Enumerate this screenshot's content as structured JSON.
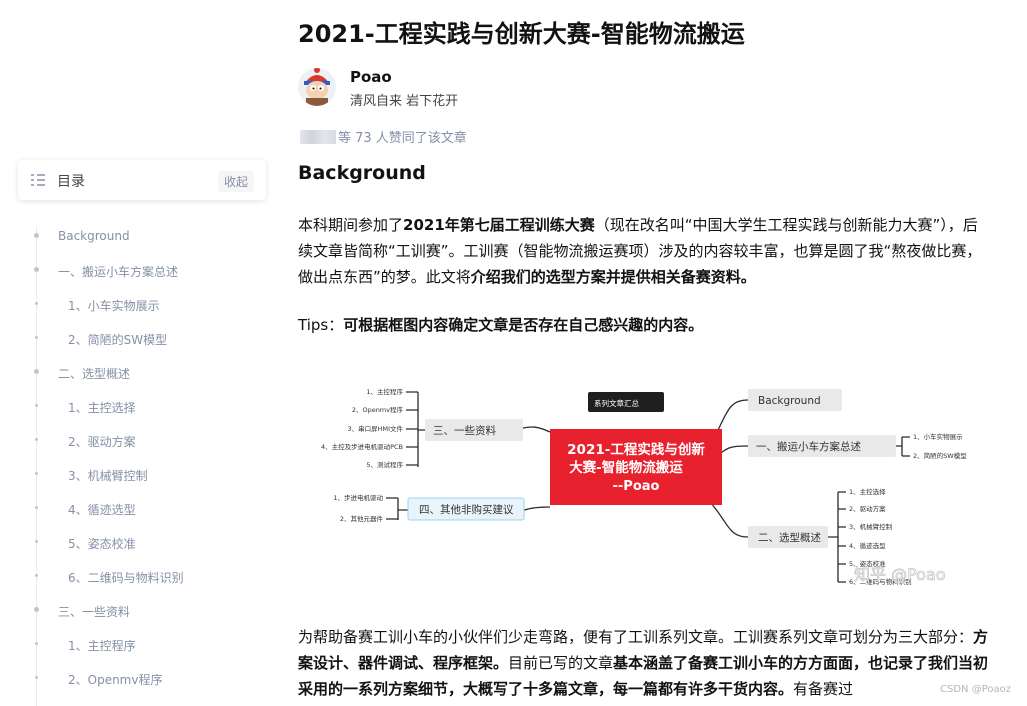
{
  "article": {
    "title": "2021-工程实践与创新大赛-智能物流搬运",
    "author": {
      "name": "Poao",
      "bio": "清风自来 岩下花开"
    },
    "likes_text": "等 73 人赞同了该文章"
  },
  "toc": {
    "title": "目录",
    "collapse_label": "收起",
    "items": [
      {
        "label": "Background",
        "level": 1
      },
      {
        "label": "一、搬运小车方案总述",
        "level": 1
      },
      {
        "label": "1、小车实物展示",
        "level": 2
      },
      {
        "label": "2、简陋的SW模型",
        "level": 2
      },
      {
        "label": "二、选型概述",
        "level": 1
      },
      {
        "label": "1、主控选择",
        "level": 2
      },
      {
        "label": "2、驱动方案",
        "level": 2
      },
      {
        "label": "3、机械臂控制",
        "level": 2
      },
      {
        "label": "4、循迹选型",
        "level": 2
      },
      {
        "label": "5、姿态校准",
        "level": 2
      },
      {
        "label": "6、二维码与物料识别",
        "level": 2
      },
      {
        "label": "三、一些资料",
        "level": 1
      },
      {
        "label": "1、主控程序",
        "level": 2
      },
      {
        "label": "2、Openmv程序",
        "level": 2
      }
    ]
  },
  "content": {
    "heading": "Background",
    "p1": {
      "a": "本科期间参加了",
      "b": "2021年第七届工程训练大赛",
      "c": "（现在改名叫“中国大学生工程实践与创新能力大赛”），后续文章皆简称“工训赛”。工训赛（智能物流搬运赛项）涉及的内容较丰富，也算是圆了我“熬夜做比赛，做出点东西”的梦。此文将",
      "d": "介绍我们的选型方案并提供相关备赛资料。"
    },
    "p2": {
      "a": "Tips：",
      "b": "可根据框图内容确定文章是否存在自己感兴趣的内容。"
    },
    "p3": {
      "a": "为帮助备赛工训小车的小伙伴们少走弯路，便有了工训系列文章。工训赛系列文章可划分为三大部分：",
      "b": "方案设计、器件调试、程序框架。",
      "c": "目前已写的文章",
      "d": "基本涵盖了备赛工训小车的方方面面，也记录了我们当初采用的一系列方案细节，大概写了十多篇文章，每一篇都有许多干货内容。",
      "e": "有备赛过"
    }
  },
  "mindmap": {
    "center_line1": "2021-工程实践与创新",
    "center_line2": "大赛-智能物流搬运",
    "center_line3": "--Poao",
    "top_tag": "系列文章汇总",
    "left_branch1": "三、一些资料",
    "left_branch1_items": [
      "1、主控程序",
      "2、Openmv程序",
      "3、串口屏HMI文件",
      "4、主控及步进电机驱动PCB",
      "5、测试程序"
    ],
    "left_branch2": "四、其他非购买建议",
    "left_branch2_items": [
      "1、步进电机驱动",
      "2、其他元器件"
    ],
    "right_branch0": "Background",
    "right_branch1": "一、搬运小车方案总述",
    "right_branch1_items": [
      "1、小车实物展示",
      "2、简陋的SW模型"
    ],
    "right_branch2": "二、选型概述",
    "right_branch2_items": [
      "1、主控选择",
      "2、驱动方案",
      "3、机械臂控制",
      "4、循迹选型",
      "5、姿态校准",
      "6、二维码与物料识别"
    ],
    "watermark": "知乎 @Poao"
  },
  "corner_watermark": "CSDN @Poaoz",
  "colors": {
    "accent_red": "#e8212f",
    "muted": "#8590a6"
  }
}
